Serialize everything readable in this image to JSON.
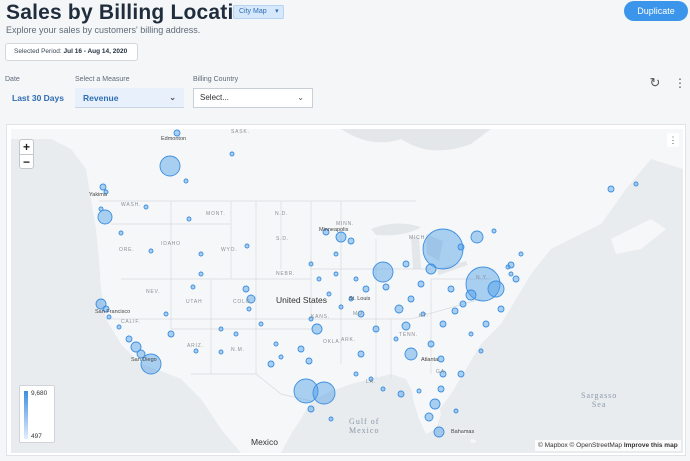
{
  "header": {
    "title": "Sales by Billing Location",
    "view_select": "City Map",
    "subtitle": "Explore your sales by customers' billing address.",
    "duplicate_label": "Duplicate"
  },
  "period": {
    "label": "Selected Period:",
    "value": "Jul 16 - Aug 14, 2020"
  },
  "filters": {
    "date_label": "Date",
    "date_value": "Last 30 Days",
    "measure_label": "Select a Measure",
    "measure_value": "Revenue",
    "country_label": "Billing Country",
    "country_placeholder": "Select..."
  },
  "map": {
    "zoom_in": "+",
    "zoom_out": "−",
    "legend_max": "9,680",
    "legend_min": "497",
    "attribution_mapbox": "© Mapbox",
    "attribution_osm": "© OpenStreetMap",
    "attribution_improve": "Improve this map",
    "labels": {
      "edmonton": "Edmonton",
      "sask": "SASK.",
      "wash": "WASH.",
      "mont": "MONT.",
      "ore": "ORE.",
      "idaho": "IDAHO",
      "wyo": "WYO.",
      "nd": "N.D.",
      "sd": "S.D.",
      "minn": "MINN.",
      "minneapolis": "Minneapolis",
      "mich": "MICH.",
      "nebr": "NEBR.",
      "nev": "NEV.",
      "utah": "UTAH",
      "colo": "COLO.",
      "kans": "KANS.",
      "mo": "MO.",
      "stlouis": "St. Louis",
      "united_states": "United States",
      "calif": "CALIF.",
      "sanfrancisco": "San Francisco",
      "ariz": "ARIZ.",
      "nm": "N.M.",
      "okla": "OKLA.",
      "ark": "ARK.",
      "tenn": "TENN.",
      "ny": "N.Y.",
      "ky": "KY.",
      "ga": "GA.",
      "la": "LA.",
      "atlanta": "Atlanta",
      "mexico": "Mexico",
      "gulf1": "Gulf of",
      "gulf2": "Mexico",
      "sargasso1": "Sargasso",
      "sargasso2": "Sea",
      "bahamas": "Bahamas",
      "yakima": "Yakima",
      "sandiego": "San Diego"
    }
  },
  "colors": {
    "accent": "#3b95ea",
    "bubble": "#4a9be6",
    "water": "#e9ecef",
    "land": "#f6f7f8"
  }
}
